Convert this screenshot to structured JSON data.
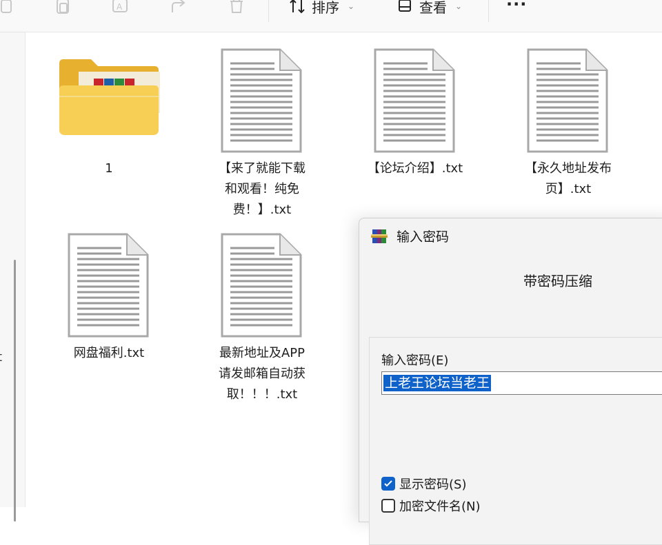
{
  "toolbar": {
    "sort_label": "排序",
    "view_label": "查看",
    "more_label": "···"
  },
  "nav": {
    "partial_text": "t"
  },
  "files": [
    {
      "name": "1",
      "kind": "folder"
    },
    {
      "name_lines": [
        "【来了就能下载",
        "和观看！纯免",
        "费！】.txt"
      ],
      "kind": "txt"
    },
    {
      "name_lines": [
        "【论坛介绍】.txt"
      ],
      "kind": "txt"
    },
    {
      "name_lines": [
        "【永久地址发布",
        "页】.txt"
      ],
      "kind": "txt"
    },
    {
      "name_lines": [
        "网盘福利.txt"
      ],
      "kind": "txt"
    },
    {
      "name_lines": [
        "最新地址及APP",
        "请发邮箱自动获",
        "取！！！.txt"
      ],
      "kind": "txt"
    }
  ],
  "dialog": {
    "title": "输入密码",
    "heading": "带密码压缩",
    "password_label": "输入密码(E)",
    "password_value": "上老王论坛当老王",
    "show_password_label": "显示密码(S)",
    "show_password_checked": true,
    "encrypt_names_label": "加密文件名(N)",
    "encrypt_names_checked": false
  }
}
